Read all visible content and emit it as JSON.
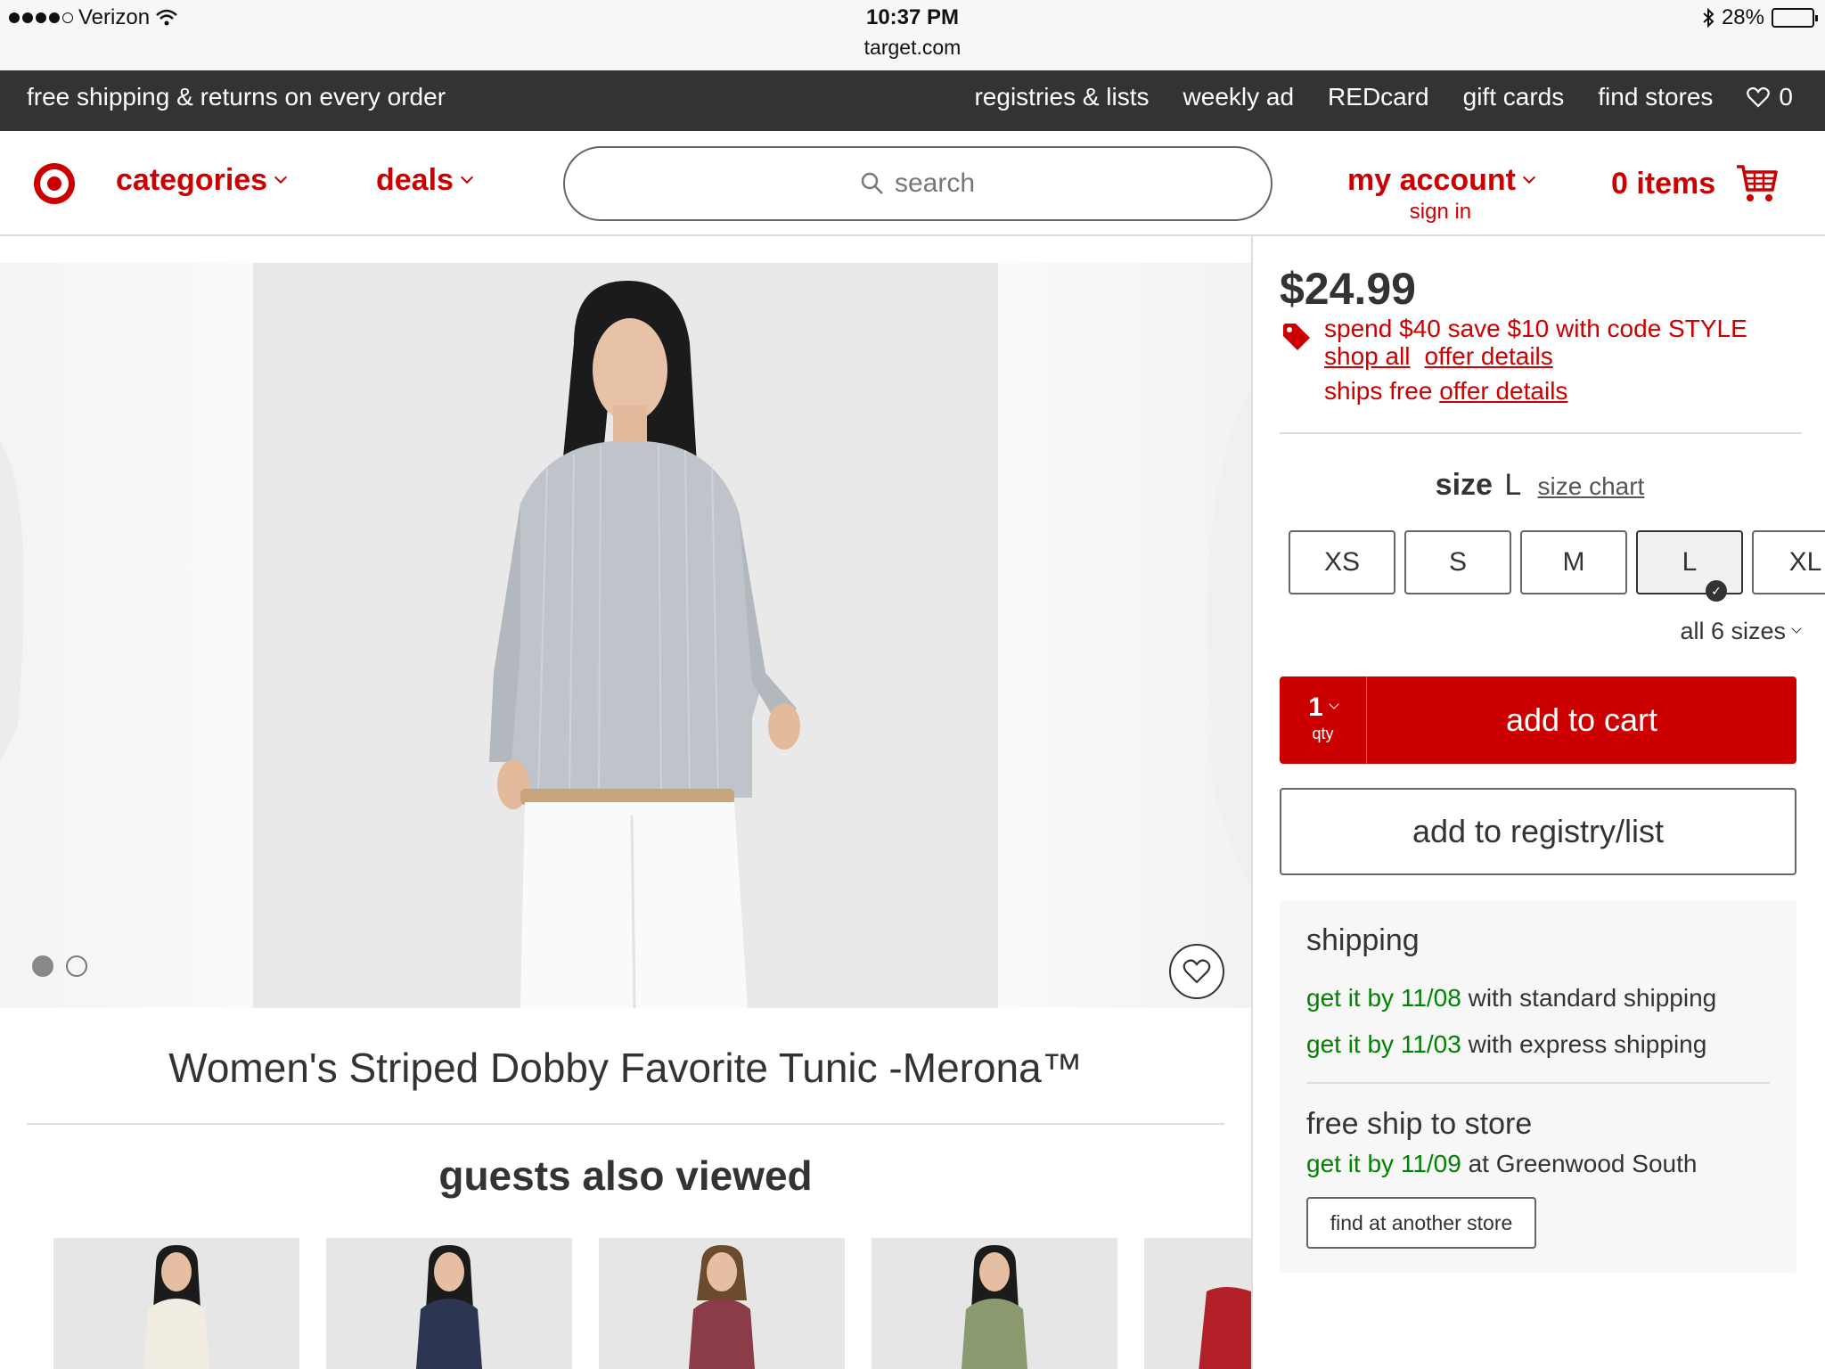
{
  "status_bar": {
    "carrier": "Verizon",
    "time": "10:37 PM",
    "url": "target.com",
    "battery": "28%"
  },
  "promo_bar": {
    "left": "free shipping & returns on every order",
    "links": [
      "registries & lists",
      "weekly ad",
      "REDcard",
      "gift cards",
      "find stores"
    ],
    "favorites_count": "0"
  },
  "header": {
    "categories": "categories",
    "deals": "deals",
    "search_placeholder": "search",
    "account": "my account",
    "sign_in": "sign in",
    "cart": "0 items"
  },
  "product": {
    "title": "Women's Striped Dobby Favorite Tunic -Merona™",
    "price": "$24.99",
    "promo": "spend $40 save $10 with code STYLE",
    "shop_all": "shop all",
    "offer_details": "offer details",
    "ships_free": "ships free",
    "ships_offer_details": "offer details",
    "size_label": "size",
    "size_value": "L",
    "size_chart": "size chart",
    "sizes": [
      "XS",
      "S",
      "M",
      "L",
      "XL"
    ],
    "selected_size": "L",
    "all_sizes": "all 6 sizes",
    "qty": "1",
    "qty_label": "qty",
    "add_to_cart": "add to cart",
    "add_to_registry": "add to registry/list"
  },
  "shipping": {
    "title": "shipping",
    "standard_date": "get it by 11/08",
    "standard_text": "with standard shipping",
    "express_date": "get it by 11/03",
    "express_text": "with express shipping",
    "store_title": "free ship to store",
    "store_date": "get it by 11/09",
    "store_text": "at Greenwood South",
    "find_store": "find at another store"
  },
  "also_viewed": {
    "title": "guests also viewed"
  },
  "colors": {
    "brand_red": "#cc0000",
    "green": "#008300",
    "dark_bar": "#333333"
  }
}
